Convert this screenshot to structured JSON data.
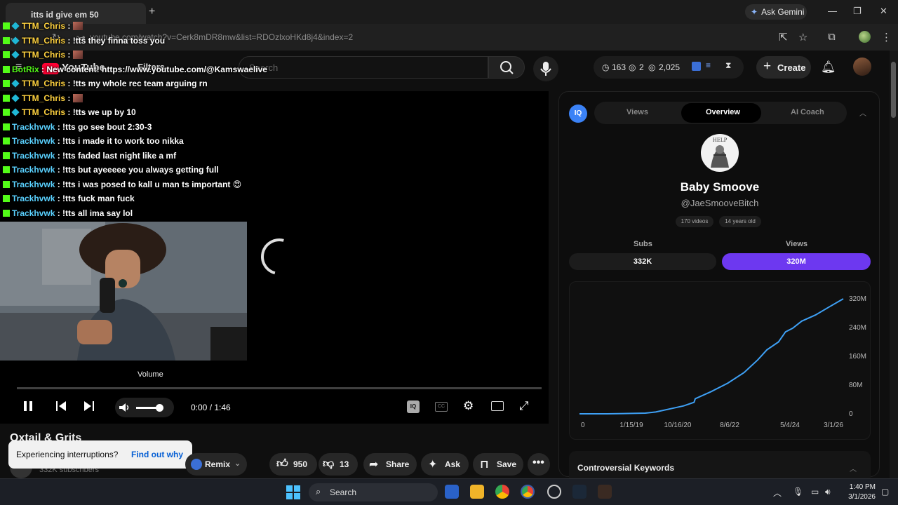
{
  "browser": {
    "tab_title": "itts id give em 50",
    "gemini_label": "Ask Gemini",
    "url": "youtube.com/watch?v=Cerk8mDR8mw&list=RDOzlxoHKd8j4&index=2"
  },
  "header": {
    "logo_text": "YouTube",
    "filter_label": "Filters",
    "search_placeholder": "Search",
    "stats": {
      "time": "163",
      "views_a": "2",
      "views_b": "2,025"
    },
    "create_label": "Create"
  },
  "chat": [
    {
      "user": "TTM_Chris",
      "msg": "",
      "emote": true,
      "user_color": "yellow"
    },
    {
      "user": "TTM_Chris",
      "msg": "!tts they finna toss you",
      "emote": false,
      "user_color": "yellow"
    },
    {
      "user": "TTM_Chris",
      "msg": "",
      "emote": true,
      "user_color": "yellow"
    },
    {
      "user": "BotRix",
      "msg": "New content! https://www.youtube.com/@Kamswaelive",
      "emote": false,
      "user_color": "bot"
    },
    {
      "user": "TTM_Chris",
      "msg": "!tts my whole rec team arguing rn",
      "emote": false,
      "user_color": "yellow"
    },
    {
      "user": "TTM_Chris",
      "msg": "",
      "emote": true,
      "user_color": "yellow"
    },
    {
      "user": "TTM_Chris",
      "msg": "!tts we up by 10",
      "emote": false,
      "user_color": "yellow"
    },
    {
      "user": "Trackhvwk",
      "msg": "!tts go see bout 2:30-3",
      "emote": false,
      "user_color": "blue"
    },
    {
      "user": "Trackhvwk",
      "msg": "!tts i made it to work too nikka",
      "emote": false,
      "user_color": "blue"
    },
    {
      "user": "Trackhvwk",
      "msg": "!tts faded last night like a mf",
      "emote": false,
      "user_color": "blue"
    },
    {
      "user": "Trackhvwk",
      "msg": "!tts but ayeeeee you always getting full",
      "emote": false,
      "user_color": "blue"
    },
    {
      "user": "Trackhvwk",
      "msg": "!tts i was posed to kall u man ts important 😍",
      "emote": false,
      "user_color": "blue"
    },
    {
      "user": "Trackhvwk",
      "msg": "!tts fuck man fuck",
      "emote": false,
      "user_color": "blue"
    },
    {
      "user": "Trackhvwk",
      "msg": "!tts all ima say lol",
      "emote": false,
      "user_color": "blue"
    }
  ],
  "player": {
    "volume_tooltip": "Volume",
    "time_display": "0:00 / 1:46",
    "volume_level": 0.75,
    "progress": 0.0,
    "iq_label": "IQ",
    "cc_label": "CC"
  },
  "video": {
    "title": "Oxtail & Grits",
    "subscribers": "332K subscribers",
    "remix_label": "Remix",
    "likes": "950",
    "dislikes": "13",
    "share_label": "Share",
    "ask_label": "Ask",
    "save_label": "Save"
  },
  "toast": {
    "text": "Experiencing interruptions?",
    "link": "Find out why"
  },
  "panel": {
    "logo": "IQ",
    "tabs": [
      "Views",
      "Overview",
      "AI Coach"
    ],
    "active_tab": "Overview",
    "avatar_text": "HELP",
    "channel_name": "Baby Smoove",
    "handle": "@JaeSmooveBitch",
    "meta": [
      "170 videos",
      "14 years old"
    ],
    "subs_label": "Subs",
    "views_label": "Views",
    "subs_value": "332K",
    "views_value": "320M",
    "controversial_label": "Controversial Keywords"
  },
  "chart_data": {
    "type": "line",
    "title": "",
    "xlabel": "",
    "ylabel": "",
    "x_ticks": [
      "0",
      "1/15/19",
      "10/16/20",
      "8/6/22",
      "5/4/24",
      "3/1/26"
    ],
    "y_ticks": [
      "0",
      "80M",
      "160M",
      "240M",
      "320M"
    ],
    "ylim": [
      0,
      320
    ],
    "y_unit": "M",
    "series": [
      {
        "color": "#3ea0f5",
        "x": [
          "2016-09-01",
          "2017-09-01",
          "2018-06-01",
          "2019-01-15",
          "2019-06-01",
          "2020-01-01",
          "2020-06-01",
          "2020-10-16",
          "2020-11-01",
          "2021-06-01",
          "2022-01-01",
          "2022-08-06",
          "2023-02-01",
          "2023-06-01",
          "2023-11-01",
          "2024-02-01",
          "2024-05-04",
          "2024-09-01",
          "2025-03-01",
          "2025-09-01",
          "2026-03-01"
        ],
        "y": [
          0,
          0,
          1,
          2,
          5,
          15,
          22,
          32,
          42,
          62,
          85,
          115,
          150,
          178,
          200,
          228,
          238,
          258,
          275,
          298,
          320
        ]
      }
    ],
    "grid": false,
    "legend": "none"
  },
  "taskbar": {
    "search_label": "Search",
    "time": "1:40 PM",
    "date": "3/1/2026"
  },
  "colors": {
    "accent_purple": "#6d38f0",
    "line_blue": "#3ea0f5",
    "youtube_red": "#ff0033",
    "kick_green": "#53fc18"
  }
}
